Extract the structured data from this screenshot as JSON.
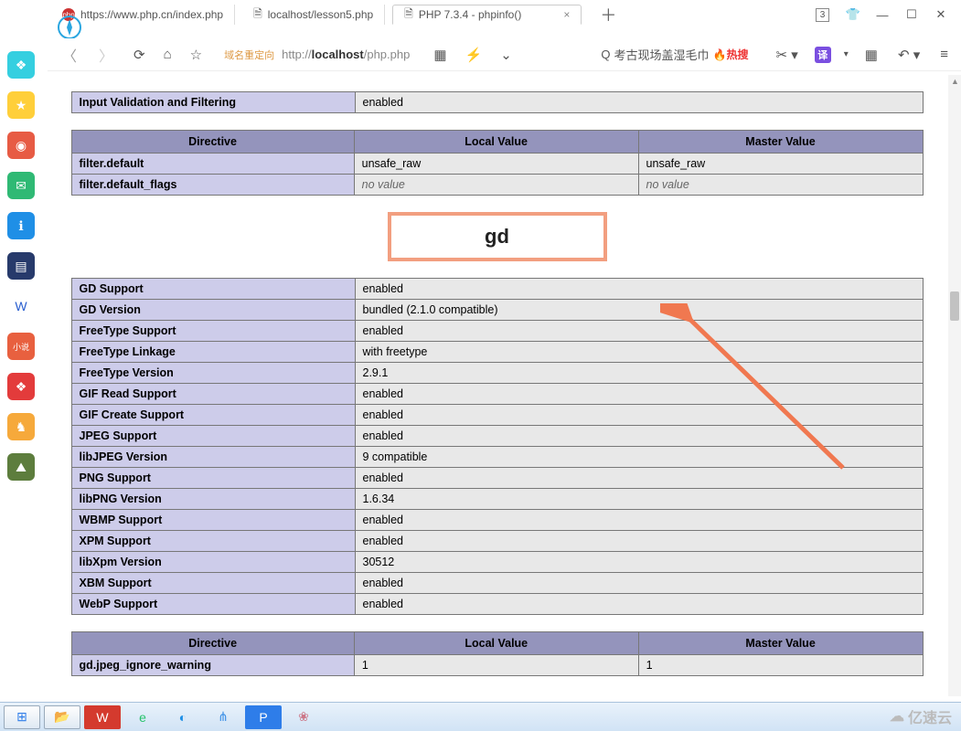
{
  "window": {
    "tab_badge": "3",
    "tabs": [
      {
        "icon": "php",
        "label": "https://www.php.cn/index.php"
      },
      {
        "icon": "doc",
        "label": "localhost/lesson5.php"
      },
      {
        "icon": "doc",
        "label": "PHP 7.3.4 - phpinfo()"
      }
    ],
    "toolbar": {
      "addr_prefix": "域名重定向",
      "addr_url_plain1": "http://",
      "addr_url_bold": "localhost",
      "addr_url_plain2": "/php.php",
      "search_icon": "Q",
      "search_text": "考古现场盖湿毛巾",
      "hot_label": "热搜",
      "translate_label": "译"
    }
  },
  "phpinfo": {
    "input_filtering_label": "Input Validation and Filtering",
    "input_filtering_value": "enabled",
    "directives_header": {
      "c1": "Directive",
      "c2": "Local Value",
      "c3": "Master Value"
    },
    "filter_directives": [
      {
        "name": "filter.default",
        "local": "unsafe_raw",
        "master": "unsafe_raw",
        "italic": false
      },
      {
        "name": "filter.default_flags",
        "local": "no value",
        "master": "no value",
        "italic": true
      }
    ],
    "section_title": "gd",
    "gd_rows": [
      {
        "k": "GD Support",
        "v": "enabled"
      },
      {
        "k": "GD Version",
        "v": "bundled (2.1.0 compatible)"
      },
      {
        "k": "FreeType Support",
        "v": "enabled"
      },
      {
        "k": "FreeType Linkage",
        "v": "with freetype"
      },
      {
        "k": "FreeType Version",
        "v": "2.9.1"
      },
      {
        "k": "GIF Read Support",
        "v": "enabled"
      },
      {
        "k": "GIF Create Support",
        "v": "enabled"
      },
      {
        "k": "JPEG Support",
        "v": "enabled"
      },
      {
        "k": "libJPEG Version",
        "v": "9 compatible"
      },
      {
        "k": "PNG Support",
        "v": "enabled"
      },
      {
        "k": "libPNG Version",
        "v": "1.6.34"
      },
      {
        "k": "WBMP Support",
        "v": "enabled"
      },
      {
        "k": "XPM Support",
        "v": "enabled"
      },
      {
        "k": "libXpm Version",
        "v": "30512"
      },
      {
        "k": "XBM Support",
        "v": "enabled"
      },
      {
        "k": "WebP Support",
        "v": "enabled"
      }
    ],
    "gd_directives": [
      {
        "name": "gd.jpeg_ignore_warning",
        "local": "1",
        "master": "1"
      }
    ]
  },
  "sidebar_icons": [
    {
      "name": "browser-logo-icon",
      "bg": "#ffffff",
      "glyph": "e",
      "color": "#27c36b"
    },
    {
      "name": "link-icon",
      "bg": "#35cfe0",
      "glyph": "❖"
    },
    {
      "name": "star-icon",
      "bg": "#ffcf3a",
      "glyph": "★"
    },
    {
      "name": "weibo-icon",
      "bg": "#e75b44",
      "glyph": "◉"
    },
    {
      "name": "mail-icon",
      "bg": "#2fb974",
      "glyph": "✉"
    },
    {
      "name": "info-icon",
      "bg": "#1f8fe6",
      "glyph": "ℹ"
    },
    {
      "name": "doc-icon",
      "bg": "#273a6b",
      "glyph": "▤",
      "color": "#fff"
    },
    {
      "name": "word-icon",
      "bg": "#ffffff",
      "glyph": "W",
      "color": "#2a5fcf"
    },
    {
      "name": "novel-icon",
      "bg": "#e8603f",
      "glyph": "小说",
      "fs": "9px"
    },
    {
      "name": "red-icon",
      "bg": "#e33b3b",
      "glyph": "❖"
    },
    {
      "name": "game1-icon",
      "bg": "#f6a93b",
      "glyph": "♞"
    },
    {
      "name": "game2-icon",
      "bg": "#5d7d3d",
      "glyph": "⛰"
    }
  ],
  "taskbar": [
    {
      "name": "start-icon",
      "glyph": "⊞",
      "color": "#2e7de9"
    },
    {
      "name": "explorer-icon",
      "glyph": "📂"
    },
    {
      "name": "wps-icon",
      "glyph": "W",
      "bg": "#d43a2e",
      "color": "#fff"
    },
    {
      "name": "browser-icon",
      "glyph": "e",
      "color": "#27c36b"
    },
    {
      "name": "chat-icon",
      "glyph": "◐",
      "color": "#1e8fe6"
    },
    {
      "name": "vscode-icon",
      "glyph": "⋔",
      "color": "#3a8fe6"
    },
    {
      "name": "park-icon",
      "glyph": "P",
      "bg": "#2e7de9",
      "color": "#fff"
    },
    {
      "name": "misc-icon",
      "glyph": "❀",
      "color": "#c78"
    }
  ],
  "watermark": "亿速云"
}
